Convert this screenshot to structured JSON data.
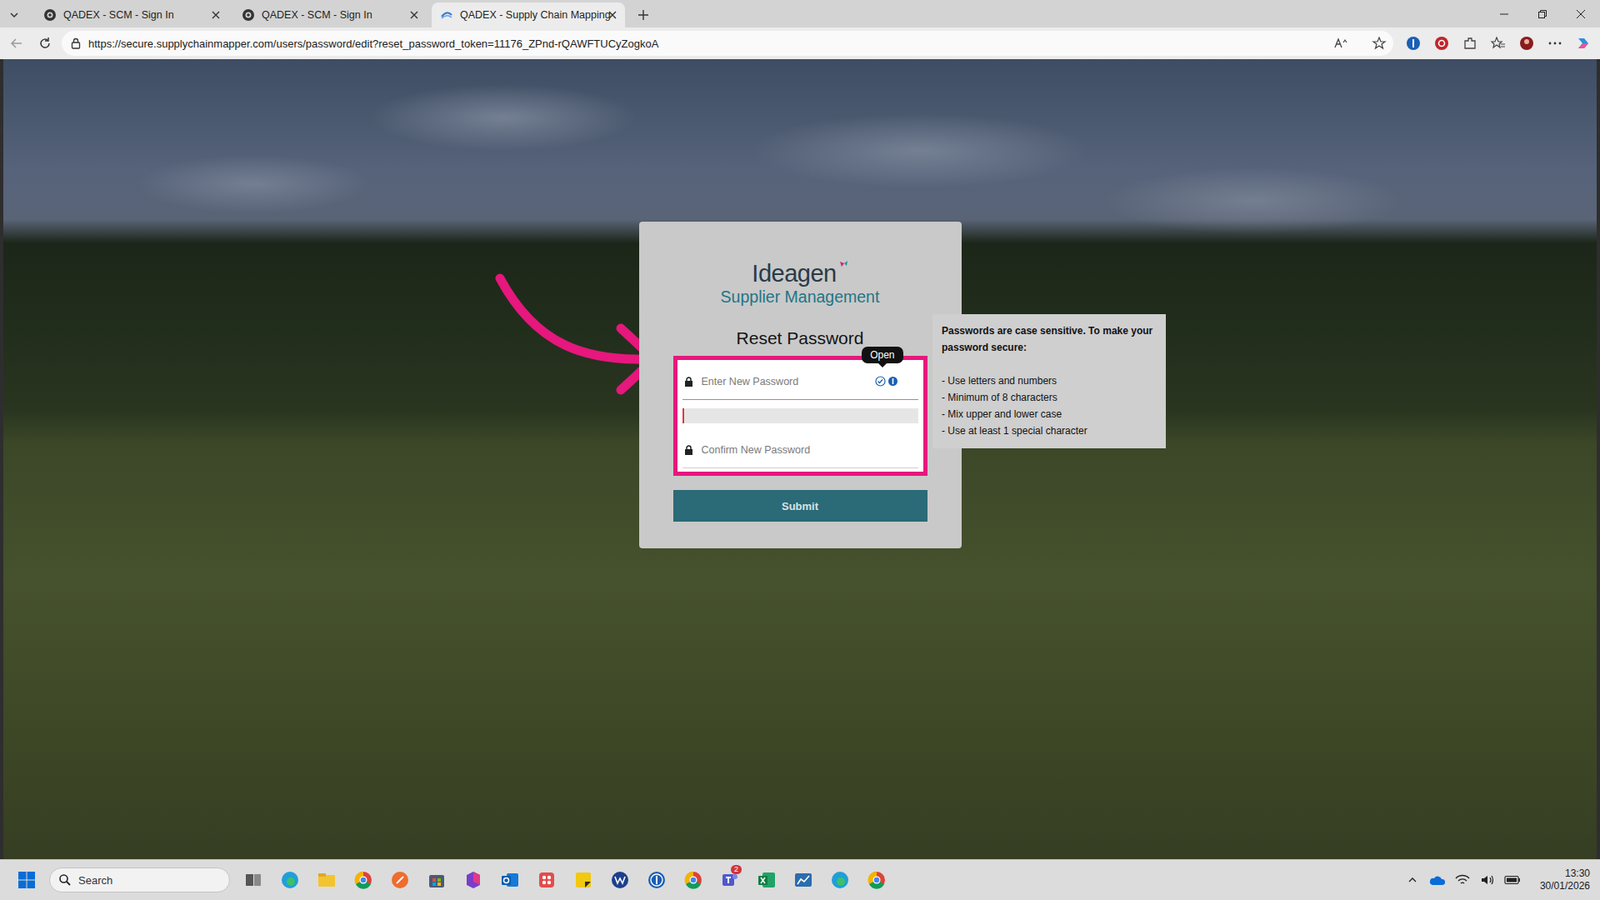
{
  "browser": {
    "tabs": [
      {
        "label": "QADEX - SCM - Sign In",
        "selected": false
      },
      {
        "label": "QADEX - SCM - Sign In",
        "selected": false
      },
      {
        "label": "QADEX - Supply Chain Mapping",
        "selected": true
      }
    ],
    "url": "https://secure.supplychainmapper.com/users/password/edit?reset_password_token=11176_ZPnd-rQAWFTUCyZogkoA"
  },
  "login_card": {
    "brand": "Ideagen",
    "product": "Supplier Management",
    "title": "Reset Password",
    "new_password": {
      "placeholder": "Enter New Password"
    },
    "strength": {
      "level": 0.01
    },
    "confirm_password": {
      "placeholder": "Confirm New Password"
    },
    "manager_tooltip": "Open",
    "submit": "Submit"
  },
  "password_help": {
    "heading": "Passwords are case sensitive. To make your password secure:",
    "rules": [
      "- Use letters and numbers",
      "- Minimum of 8 characters",
      "- Mix upper and lower case",
      "- Use at least 1 special character"
    ]
  },
  "taskbar": {
    "search": "Search",
    "teams_badge": "2",
    "time": "13:30",
    "date": "30/01/2026"
  }
}
